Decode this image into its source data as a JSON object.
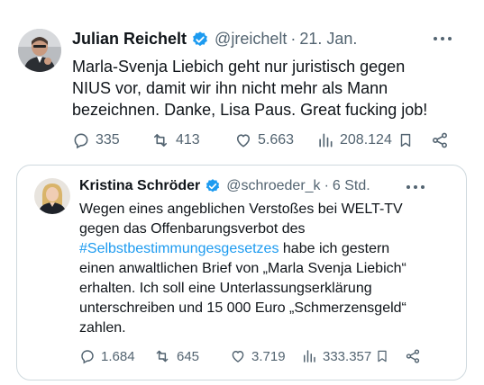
{
  "tweet": {
    "author_name": "Julian Reichelt",
    "handle": "@jreichelt",
    "separator": "·",
    "time": "21. Jan.",
    "lines": [
      "Marla-Svenja Liebich geht nur juristisch gegen",
      "NIUS vor, damit wir ihn nicht mehr als Mann",
      "bezeichnen. Danke, Lisa Paus. Great fucking job!"
    ],
    "replies": "335",
    "reposts": "413",
    "likes": "5.663",
    "views": "208.124",
    "icons": [
      "verified-badge-icon",
      "more-icon",
      "reply-icon",
      "repost-icon",
      "like-icon",
      "views-icon",
      "bookmark-icon",
      "share-icon"
    ]
  },
  "quoted": {
    "author_name": "Kristina Schröder",
    "handle": "@schroeder_k",
    "separator": "·",
    "time": "6 Std.",
    "line1": "Wegen eines angeblichen Verstoßes bei WELT-TV",
    "line2": "gegen das Offenbarungsverbot des",
    "hashtag": "#Selbstbestimmungesgesetzes",
    "line3_rest": " habe ich gestern",
    "line4": "einen anwaltlichen Brief von „Marla Svenja Liebich“",
    "line5": "erhalten. Ich soll eine Unterlassungserklärung",
    "line6": "unterschreiben und 15 000 Euro „Schmerzensgeld“",
    "line7": "zahlen.",
    "replies": "1.684",
    "reposts": "645",
    "likes": "3.719",
    "views": "333.357"
  },
  "colors": {
    "text": "#0f1419",
    "secondary": "#536471",
    "link": "#1d9bf0",
    "verified": "#1d9bf0",
    "border": "#cfd9de"
  }
}
